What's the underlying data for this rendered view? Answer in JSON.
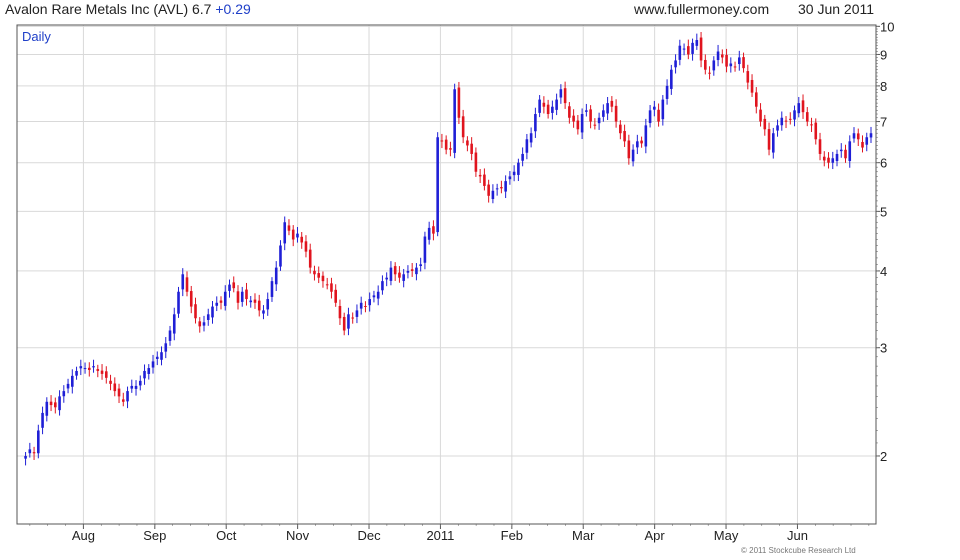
{
  "header": {
    "title": "Avalon Rare Metals Inc (AVL) 6.7",
    "change": "+0.29",
    "website": "www.fullermoney.com",
    "date": "30 Jun 2011"
  },
  "footer": {
    "copyright": "© 2011 Stockcube Research Ltd"
  },
  "colors": {
    "up": "#1f1fd6",
    "down": "#e0141e",
    "grid": "#d9d9d9",
    "label": "#1f3fc8"
  },
  "chart_data": {
    "type": "candlestick",
    "interval_label": "Daily",
    "x_tick_labels": [
      "Aug",
      "Sep",
      "Oct",
      "Nov",
      "Dec",
      "2011",
      "Feb",
      "Mar",
      "Apr",
      "May",
      "Jun"
    ],
    "x_ticks": [
      1.0,
      2.0,
      3.0,
      4.0,
      5.0,
      6.0,
      7.0,
      8.0,
      9.0,
      10.0,
      11.0
    ],
    "xlim": [
      0.07,
      12.1
    ],
    "ylim": [
      1.55,
      10.05
    ],
    "y_ticks": [
      2,
      3,
      4,
      5,
      6,
      7,
      8,
      9,
      10
    ],
    "y_scale": "log",
    "grid": true,
    "y_axis_position": "right",
    "closes": [
      2.0,
      2.05,
      2.02,
      2.2,
      2.35,
      2.45,
      2.42,
      2.4,
      2.5,
      2.55,
      2.62,
      2.7,
      2.75,
      2.8,
      2.78,
      2.76,
      2.8,
      2.75,
      2.72,
      2.68,
      2.62,
      2.55,
      2.5,
      2.45,
      2.55,
      2.6,
      2.6,
      2.65,
      2.75,
      2.78,
      2.85,
      2.9,
      2.95,
      3.05,
      3.2,
      3.4,
      3.7,
      3.95,
      3.7,
      3.5,
      3.35,
      3.25,
      3.3,
      3.4,
      3.5,
      3.55,
      3.55,
      3.7,
      3.8,
      3.75,
      3.55,
      3.7,
      3.6,
      3.58,
      3.55,
      3.45,
      3.45,
      3.6,
      3.85,
      4.05,
      4.4,
      4.8,
      4.65,
      4.5,
      4.6,
      4.45,
      4.3,
      4.05,
      3.95,
      3.9,
      3.85,
      3.8,
      3.7,
      3.55,
      3.35,
      3.2,
      3.4,
      3.35,
      3.45,
      3.55,
      3.5,
      3.6,
      3.65,
      3.7,
      3.85,
      3.9,
      4.05,
      3.95,
      3.9,
      3.95,
      4.0,
      4.0,
      4.05,
      4.1,
      4.55,
      4.7,
      4.6,
      6.6,
      6.5,
      6.3,
      6.3,
      7.9,
      7.1,
      6.6,
      6.4,
      6.2,
      5.8,
      5.7,
      5.5,
      5.3,
      5.4,
      5.45,
      5.45,
      5.6,
      5.7,
      5.8,
      6.0,
      6.2,
      6.55,
      6.7,
      7.2,
      7.6,
      7.4,
      7.2,
      7.4,
      7.6,
      7.9,
      7.5,
      7.1,
      7.0,
      6.8,
      7.2,
      7.3,
      7.0,
      6.9,
      7.1,
      7.3,
      7.5,
      7.4,
      7.0,
      6.7,
      6.5,
      6.1,
      6.3,
      6.5,
      6.45,
      6.9,
      7.3,
      7.4,
      7.0,
      7.6,
      8.0,
      8.5,
      8.8,
      9.3,
      9.2,
      9.0,
      9.4,
      9.5,
      8.8,
      8.5,
      8.4,
      8.8,
      9.1,
      8.9,
      8.6,
      8.7,
      8.6,
      8.9,
      8.55,
      8.1,
      7.8,
      7.4,
      7.0,
      6.8,
      6.3,
      6.7,
      6.9,
      7.1,
      7.0,
      7.05,
      7.3,
      7.5,
      7.25,
      7.0,
      6.9,
      6.55,
      6.2,
      6.05,
      6.0,
      6.1,
      6.2,
      6.3,
      6.1,
      6.5,
      6.7,
      6.55,
      6.35,
      6.6,
      6.7
    ]
  }
}
